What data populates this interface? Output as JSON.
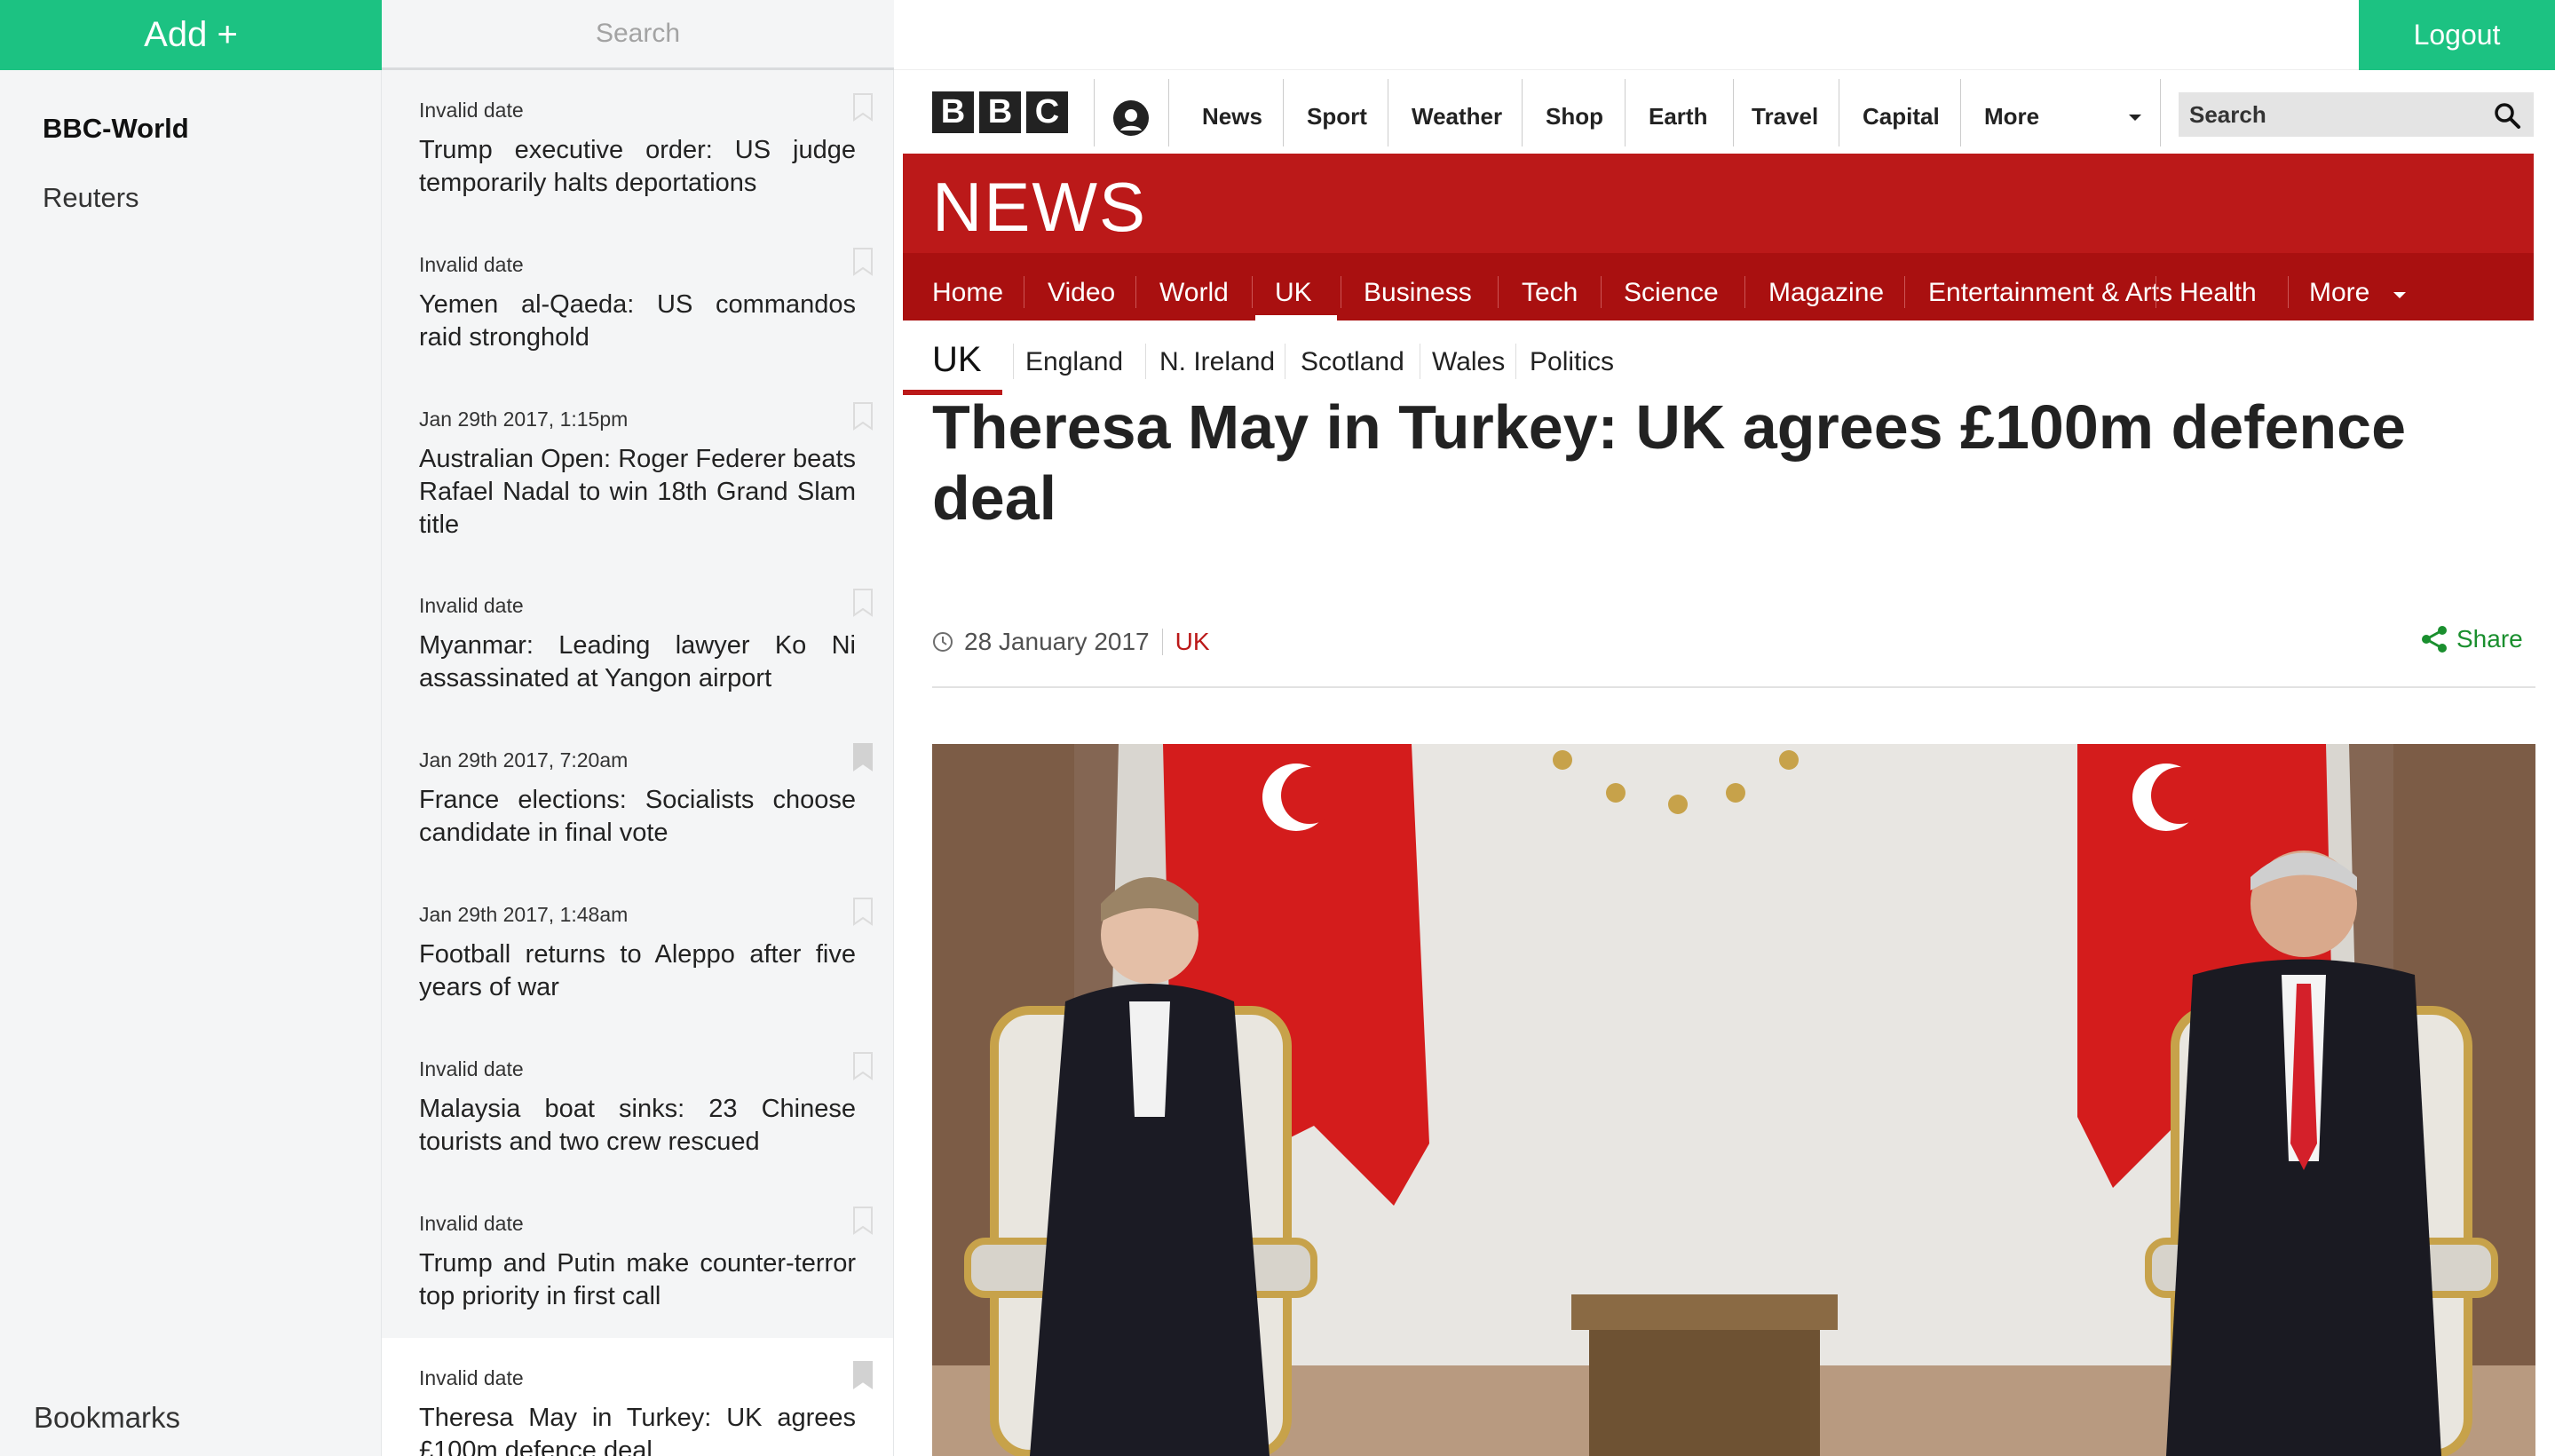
{
  "app": {
    "add_label": "Add +",
    "search_placeholder": "Search",
    "logout_label": "Logout",
    "accent_color": "#1cc282"
  },
  "sources": {
    "items": [
      {
        "label": "BBC-World",
        "active": true
      },
      {
        "label": "Reuters",
        "active": false
      }
    ],
    "bookmarks_label": "Bookmarks"
  },
  "articles": [
    {
      "date": "Invalid date",
      "title": "Trump executive order: US judge temporarily halts deportations",
      "bookmarked": false
    },
    {
      "date": "Invalid date",
      "title": "Yemen al-Qaeda: US commandos raid stronghold",
      "bookmarked": false
    },
    {
      "date": "Jan 29th 2017, 1:15pm",
      "title": "Australian Open: Roger Federer beats Rafael Nadal to win 18th Grand Slam title",
      "bookmarked": false
    },
    {
      "date": "Invalid date",
      "title": "Myanmar: Leading lawyer Ko Ni assassinated at Yangon airport",
      "bookmarked": false
    },
    {
      "date": "Jan 29th 2017, 7:20am",
      "title": "France elections: Socialists choose candidate in final vote",
      "bookmarked": true
    },
    {
      "date": "Jan 29th 2017, 1:48am",
      "title": "Football returns to Aleppo after five years of war",
      "bookmarked": false
    },
    {
      "date": "Invalid date",
      "title": "Malaysia boat sinks: 23 Chinese tourists and two crew rescued",
      "bookmarked": false
    },
    {
      "date": "Invalid date",
      "title": "Trump and Putin make counter-terror top priority in first call",
      "bookmarked": false
    },
    {
      "date": "Invalid date",
      "title": "Theresa May in Turkey: UK agrees £100m defence deal",
      "bookmarked": true,
      "selected": true
    }
  ],
  "bbc": {
    "logo_letters": [
      "B",
      "B",
      "C"
    ],
    "nav": [
      "News",
      "Sport",
      "Weather",
      "Shop",
      "Earth",
      "Travel",
      "Capital",
      "More"
    ],
    "search_placeholder": "Search",
    "news_logo": "NEWS",
    "news_nav": [
      "Home",
      "Video",
      "World",
      "UK",
      "Business",
      "Tech",
      "Science",
      "Magazine",
      "Entertainment & Arts",
      "Health",
      "More"
    ],
    "news_nav_active": "UK",
    "sub_nav": [
      "UK",
      "England",
      "N. Ireland",
      "Scotland",
      "Wales",
      "Politics"
    ],
    "red_color": "#bb1919"
  },
  "story": {
    "headline": "Theresa May in Turkey: UK agrees £100m defence deal",
    "date": "28 January 2017",
    "section": "UK",
    "share_label": "Share"
  }
}
